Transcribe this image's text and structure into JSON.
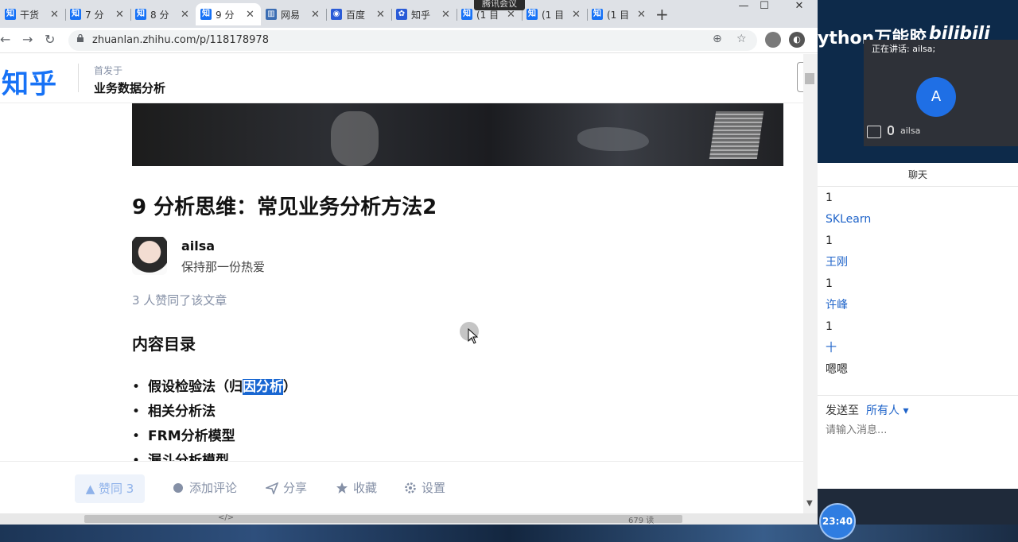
{
  "browser": {
    "tabs": [
      {
        "label": "干货",
        "favicon": "知",
        "color": "#1772f6"
      },
      {
        "label": "7 分",
        "favicon": "知",
        "color": "#1772f6"
      },
      {
        "label": "8 分",
        "favicon": "知",
        "color": "#1772f6"
      },
      {
        "label": "9 分",
        "favicon": "知",
        "color": "#1772f6",
        "active": true
      },
      {
        "label": "网易",
        "favicon": "▥",
        "color": "#3b6db3"
      },
      {
        "label": "百度",
        "favicon": "◉",
        "color": "#2a5bd7"
      },
      {
        "label": "知乎",
        "favicon": "✿",
        "color": "#2a5bd7"
      },
      {
        "label": "(1 目",
        "favicon": "知",
        "color": "#1772f6"
      },
      {
        "label": "(1 目",
        "favicon": "知",
        "color": "#1772f6"
      },
      {
        "label": "(1 目",
        "favicon": "知",
        "color": "#1772f6"
      }
    ],
    "new_tab": "+",
    "meeting_tag": "腾讯会议",
    "url": "zhuanlan.zhihu.com/p/118178978"
  },
  "zhihu": {
    "logo": "知乎",
    "published_prefix": "首发于",
    "publication": "业务数据分析",
    "article": {
      "title": "9 分析思维：常见业务分析方法2",
      "author": "ailsa",
      "author_bio": "保持那一份热爱",
      "vote_summary": "3 人赞同了该文章",
      "toc_heading": "内容目录",
      "toc_items": [
        {
          "before": "假设检验法（归",
          "highlight": "因分析",
          "after": "）"
        },
        {
          "before": "相关分析法",
          "highlight": "",
          "after": ""
        },
        {
          "before": "FRM分析模型",
          "highlight": "",
          "after": ""
        },
        {
          "before": "漏斗分析模型",
          "highlight": "",
          "after": ""
        }
      ]
    },
    "actions": {
      "vote": "▲ 赞同 3",
      "comment": "添加评论",
      "share": "分享",
      "favorite": "收藏",
      "settings": "设置"
    }
  },
  "status": {
    "code": "</>",
    "count": "679 读"
  },
  "overlay": {
    "brand": "ython万能胶",
    "bili": "bilibili"
  },
  "meeting": {
    "speaking": "正在讲话: ailsa;",
    "avatar_letter": "A",
    "participant": "ailsa",
    "chat_title": "聊天",
    "messages": [
      {
        "text": "1",
        "type": "body"
      },
      {
        "text": "SKLearn",
        "type": "sender"
      },
      {
        "text": "1",
        "type": "body"
      },
      {
        "text": "王刚",
        "type": "sender"
      },
      {
        "text": "1",
        "type": "body"
      },
      {
        "text": "许峰",
        "type": "sender"
      },
      {
        "text": "1",
        "type": "body"
      },
      {
        "text": "十",
        "type": "sender"
      },
      {
        "text": "嗯嗯",
        "type": "body"
      }
    ],
    "send_to_label": "发送至",
    "send_to_value": "所有人 ▾",
    "input_placeholder": "请输入消息...",
    "clock": "23:40"
  }
}
